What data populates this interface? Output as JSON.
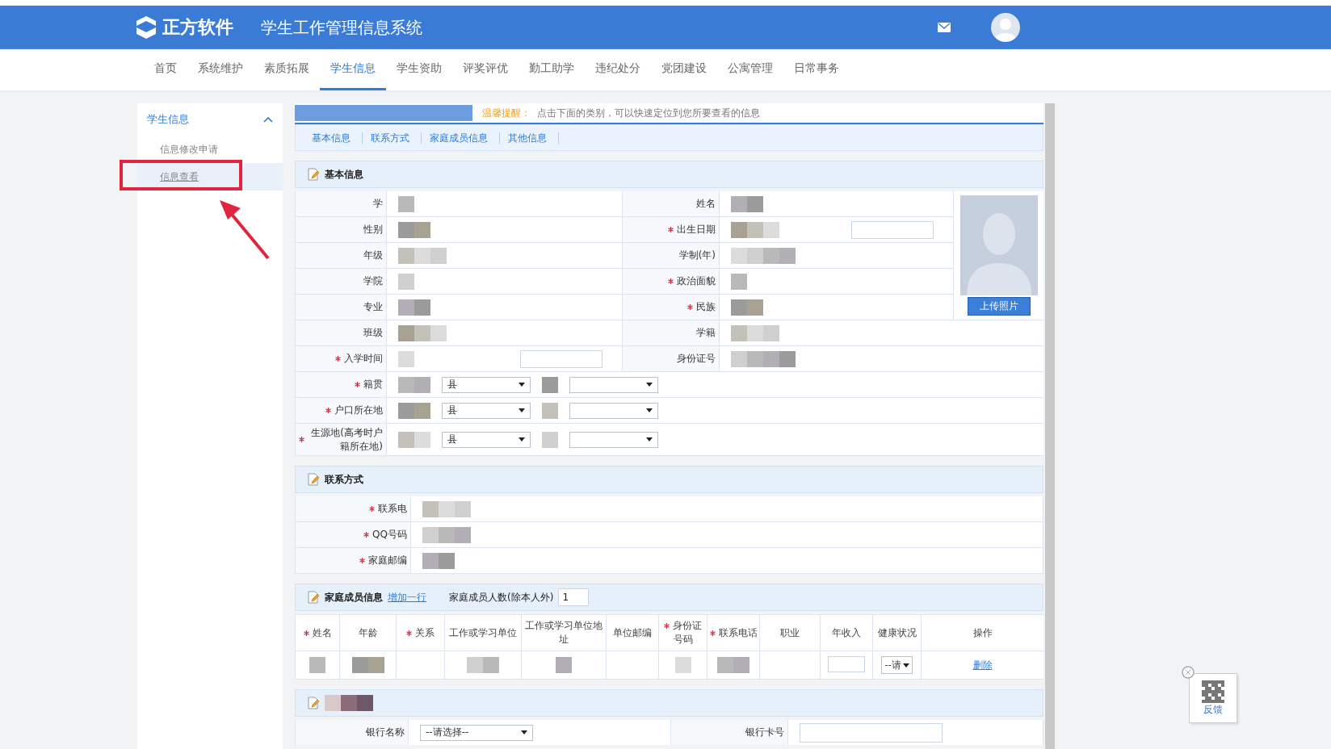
{
  "header": {
    "logo_text": "正方软件",
    "system_title": "学生工作管理信息系统"
  },
  "nav": [
    {
      "label": "首页",
      "selected": false
    },
    {
      "label": "系统维护",
      "selected": false
    },
    {
      "label": "素质拓展",
      "selected": false
    },
    {
      "label": "学生信息",
      "selected": true
    },
    {
      "label": "学生资助",
      "selected": false
    },
    {
      "label": "评奖评优",
      "selected": false
    },
    {
      "label": "勤工助学",
      "selected": false
    },
    {
      "label": "违纪处分",
      "selected": false
    },
    {
      "label": "党团建设",
      "selected": false
    },
    {
      "label": "公寓管理",
      "selected": false
    },
    {
      "label": "日常事务",
      "selected": false
    }
  ],
  "sidebar": {
    "title": "学生信息",
    "expanded": true,
    "items": [
      {
        "label": "信息修改申请",
        "selected": false
      },
      {
        "label": "信息查看",
        "selected": true
      }
    ]
  },
  "notice": {
    "label": "温馨提醒：",
    "text": "点击下面的类别，可以快速定位到您所要查看的信息"
  },
  "section_tabs": [
    "基本信息",
    "联系方式",
    "家庭成员信息",
    "其他信息"
  ],
  "basic_info": {
    "title": "基本信息",
    "upload_button": "上传照片",
    "rows": [
      {
        "kind": "pair",
        "label": "学",
        "required": false,
        "input": false,
        "label_2": "姓名",
        "required_2": false,
        "input_2": false
      },
      {
        "kind": "pair",
        "label": "性别",
        "required": false,
        "input": false,
        "label_2": "出生日期",
        "required_2": true,
        "input_2": true
      },
      {
        "kind": "pair",
        "label": "年级",
        "required": false,
        "input": false,
        "label_2": "学制(年)",
        "required_2": false,
        "input_2": false
      },
      {
        "kind": "pair",
        "label": "学院",
        "required": false,
        "input": false,
        "label_2": "政治面貌",
        "required_2": true,
        "input_2": false
      },
      {
        "kind": "pair",
        "label": "专业",
        "required": false,
        "input": false,
        "label_2": "民族",
        "required_2": true,
        "input_2": false
      },
      {
        "kind": "pair",
        "label": "班级",
        "required": false,
        "input": false,
        "label_2": "学籍",
        "required_2": false,
        "input_2": false
      },
      {
        "kind": "pair",
        "label": "入学时间",
        "required": true,
        "input": true,
        "label_2": "身份证号",
        "required_2": false,
        "input_2": false
      },
      {
        "kind": "select",
        "label": "籍贯",
        "required": true,
        "select_value": "县"
      },
      {
        "kind": "select",
        "label": "户口所在地",
        "required": true,
        "select_value": "县"
      },
      {
        "kind": "select",
        "label": "生源地(高考时户籍所在地)",
        "required": true,
        "select_value": "县"
      }
    ]
  },
  "contact": {
    "title": "联系方式",
    "rows": [
      {
        "label": "联系电",
        "required": true
      },
      {
        "label": "QQ号码",
        "required": true
      },
      {
        "label": "家庭邮编",
        "required": true
      }
    ]
  },
  "family": {
    "title": "家庭成员信息",
    "add_link": "增加一行",
    "count_label": "家庭成员人数(除本人外)",
    "count_value": "1",
    "columns": [
      {
        "label": "姓名",
        "required": true
      },
      {
        "label": "年龄",
        "required": false
      },
      {
        "label": "关系",
        "required": true
      },
      {
        "label": "工作或学习单位",
        "required": false
      },
      {
        "label": "工作或学习单位地址",
        "required": false
      },
      {
        "label": "单位邮编",
        "required": false
      },
      {
        "label": "身份证号码",
        "required": true
      },
      {
        "label": "联系电话",
        "required": true
      },
      {
        "label": "职业",
        "required": false
      },
      {
        "label": "年收入",
        "required": false
      },
      {
        "label": "健康状况",
        "required": false
      },
      {
        "label": "操作",
        "required": false
      }
    ],
    "row": {
      "health_select": "--请",
      "delete_link": "删除"
    }
  },
  "bank": {
    "name_label": "银行名称",
    "name_select": "--请选择--",
    "card_label": "银行卡号"
  },
  "feedback_widget": {
    "label": "反馈"
  }
}
